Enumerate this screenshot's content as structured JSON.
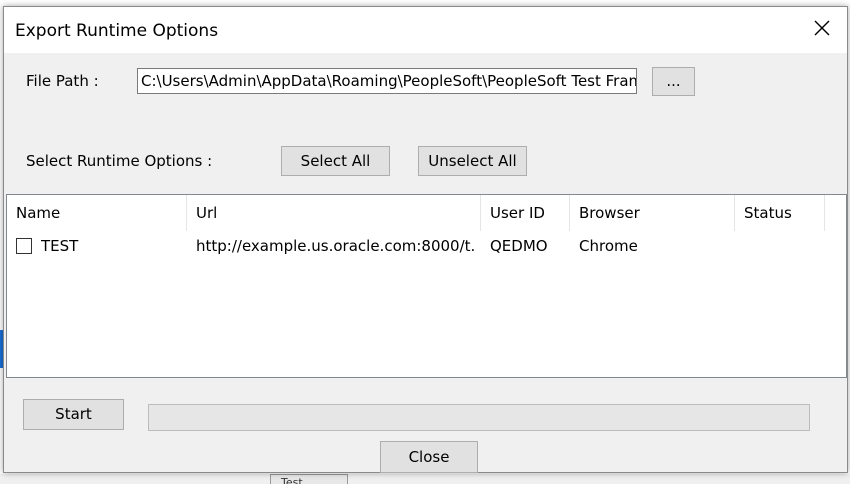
{
  "dialog": {
    "title": "Export Runtime Options",
    "close_icon": "close-icon"
  },
  "file_path": {
    "label": "File Path :",
    "value": "C:\\Users\\Admin\\AppData\\Roaming\\PeopleSoft\\PeopleSoft Test Framework",
    "browse_label": "..."
  },
  "runtime_options": {
    "label": "Select Runtime Options :",
    "select_all_label": "Select All",
    "unselect_all_label": "Unselect All"
  },
  "table": {
    "columns": [
      "Name",
      "Url",
      "User ID",
      "Browser",
      "Status"
    ],
    "rows": [
      {
        "checked": false,
        "name": "TEST",
        "url": "http://example.us.oracle.com:8000/t...",
        "user_id": "QEDMO",
        "browser": "Chrome",
        "status": ""
      }
    ]
  },
  "footer": {
    "start_label": "Start",
    "progress": 0,
    "close_label": "Close"
  },
  "background": {
    "tab_label": "Test"
  },
  "colors": {
    "dialog_bg": "#f0f0f0",
    "button_bg": "#e1e1e1",
    "accent": "#1a6fd6"
  }
}
